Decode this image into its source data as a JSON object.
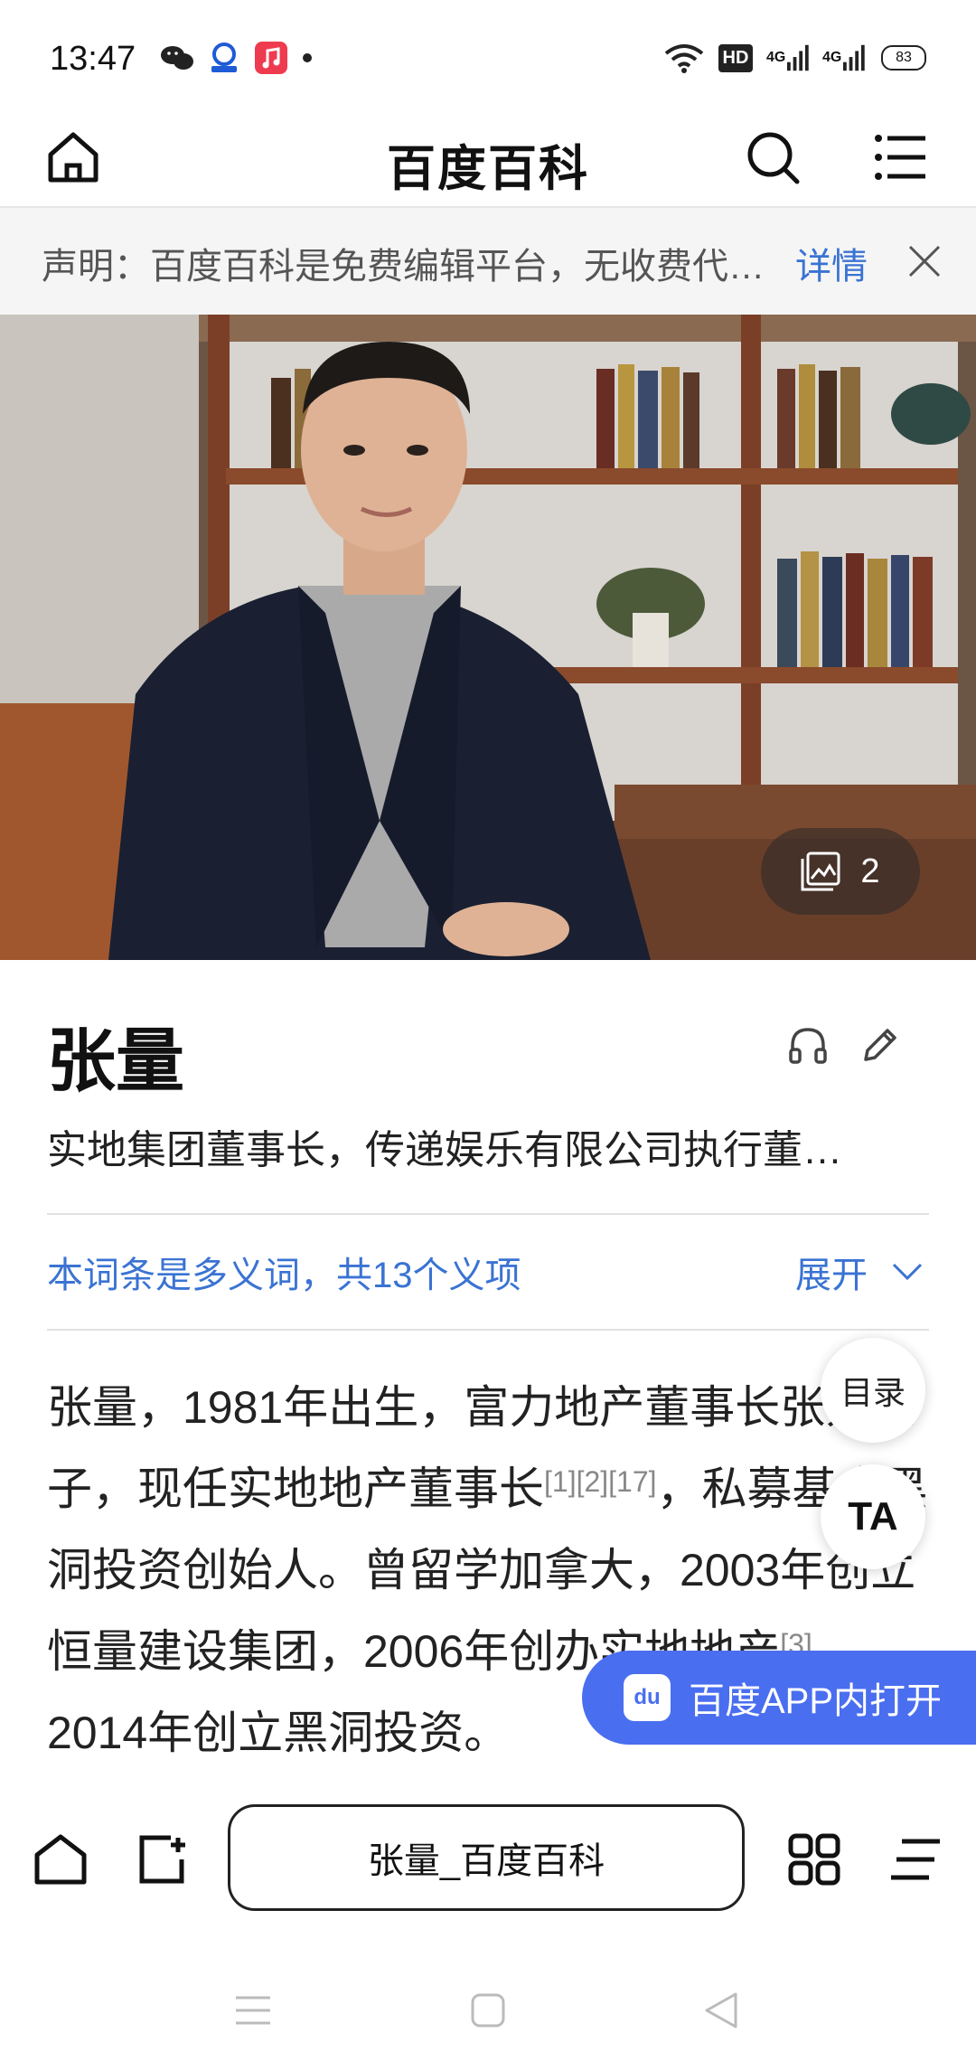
{
  "status_bar": {
    "time": "13:47",
    "notification_icons": [
      "wechat-icon",
      "app-icon",
      "music-icon",
      "dot-icon"
    ],
    "network_label": "HD",
    "signal_label_1": "4G",
    "signal_label_2": "4G",
    "battery": "83"
  },
  "header": {
    "title": "百度百科"
  },
  "notice": {
    "text": "声明：百度百科是免费编辑平台，无收费代…",
    "link": "详情"
  },
  "hero": {
    "photo_count": "2"
  },
  "entry": {
    "title": "张量",
    "subtitle": "实地集团董事长，传递娱乐有限公司执行董…",
    "polysemy_text": "本词条是多义词，共13个义项",
    "expand_label": "展开"
  },
  "body": {
    "t1": "张量，1981年出生，富力地产董事长张力之子，现任实地地产董事长",
    "r1": "[1][2][17]",
    "t2": "，私募基金黑洞投资创始人。曾留学加拿大，2003年创立恒量建设集团，2006年创办实地地产",
    "r2": "[3]",
    "t3": "，2014年创立黑洞投资",
    "t4": "。"
  },
  "floating": {
    "toc_label": "目录",
    "ta_label": "TA",
    "open_app_label": "百度APP内打开",
    "open_app_logo": "du"
  },
  "toolbar": {
    "url_text": "张量_百度百科"
  },
  "colors": {
    "accent": "#3a73d3",
    "open_app_bg": "#4a6ef0"
  }
}
